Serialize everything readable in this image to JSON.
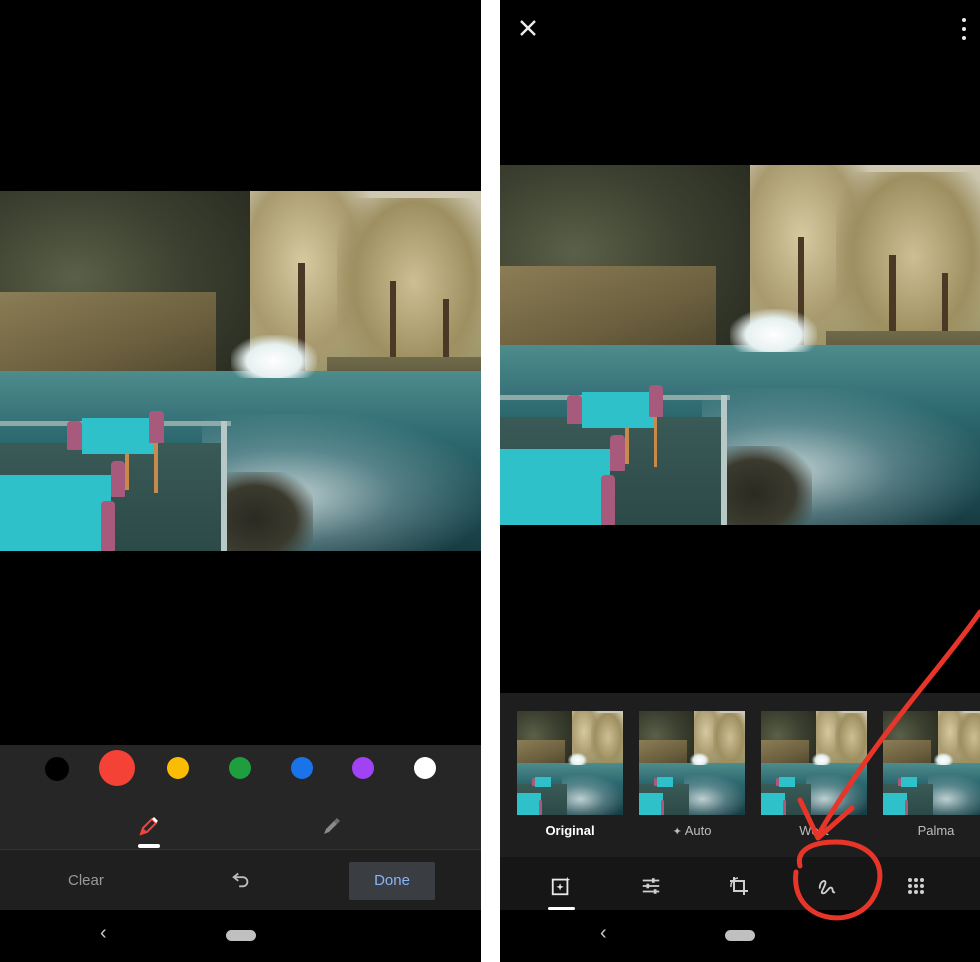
{
  "left": {
    "palette": {
      "colors": [
        {
          "name": "black",
          "hex": "#000000"
        },
        {
          "name": "red",
          "hex": "#f44336",
          "selected": true
        },
        {
          "name": "yellow",
          "hex": "#fbbc05"
        },
        {
          "name": "green",
          "hex": "#1e9e3f"
        },
        {
          "name": "blue",
          "hex": "#1a73e8"
        },
        {
          "name": "purple",
          "hex": "#a142f4"
        },
        {
          "name": "white",
          "hex": "#ffffff"
        }
      ],
      "tools": [
        {
          "name": "pen-icon",
          "selected": true
        },
        {
          "name": "highlighter-icon",
          "selected": false
        }
      ]
    },
    "actions": {
      "clear_label": "Clear",
      "undo_icon": "undo-icon",
      "done_label": "Done"
    }
  },
  "right": {
    "top_icons": [
      "close-icon",
      "more-vert-icon"
    ],
    "filters": [
      {
        "label": "Original",
        "selected": true
      },
      {
        "label": "Auto",
        "icon": "sparkle-icon",
        "selected": false
      },
      {
        "label": "West",
        "selected": false
      },
      {
        "label": "Palma",
        "selected": false
      }
    ],
    "edit_tools": [
      {
        "name": "suggestions-icon",
        "selected": true
      },
      {
        "name": "adjust-sliders-icon",
        "selected": false
      },
      {
        "name": "crop-rotate-icon",
        "selected": false
      },
      {
        "name": "markup-icon",
        "selected": false
      },
      {
        "name": "more-tools-icon",
        "selected": false
      }
    ],
    "annotation_color": "#e8352a"
  },
  "colors": {
    "accent_blue": "#8ab4f8",
    "toolbar_bg": "#262626",
    "panel_bg": "#1e1e1e"
  }
}
